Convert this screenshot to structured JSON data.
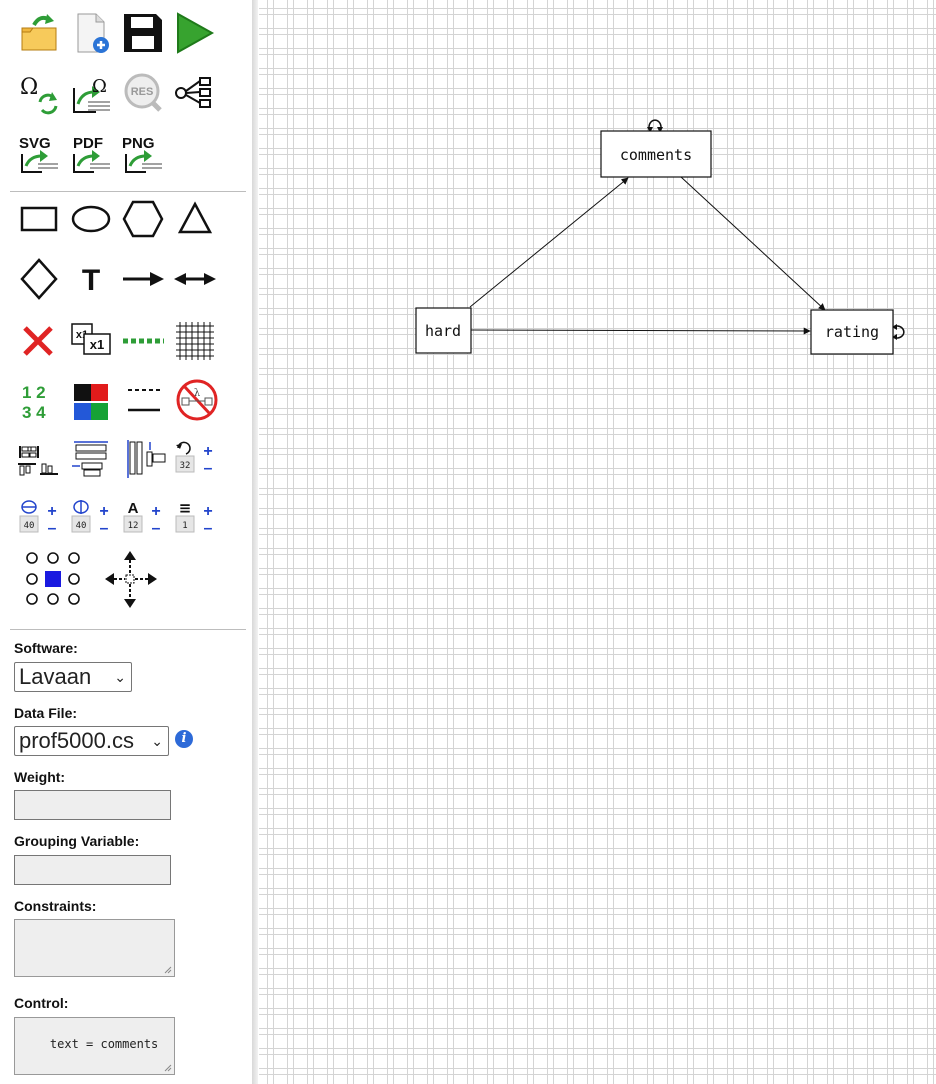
{
  "toolbar": {
    "export_svg": "SVG",
    "export_pdf": "PDF",
    "export_png": "PNG",
    "results": "RES",
    "text_tool": "T",
    "numbers_top": "1 2",
    "numbers_bottom": "3 4",
    "edge_variance": "x1",
    "edge_variance_sub": "x1",
    "rotation_value": "32",
    "width_value": "40",
    "height_value": "40",
    "font_size_value": "12",
    "line_width_value": "1",
    "glyph_omega": "Ω",
    "glyph_lambda": "λ",
    "glyph_font": "A",
    "glyph_lines": "≡",
    "glyph_plus": "+",
    "glyph_minus": "–"
  },
  "form": {
    "software_label": "Software:",
    "software_value": "Lavaan",
    "datafile_label": "Data File:",
    "datafile_value": "prof5000.cs",
    "info_glyph": "i",
    "weight_label": "Weight:",
    "weight_value": "",
    "grouping_label": "Grouping Variable:",
    "grouping_value": "",
    "constraints_label": "Constraints:",
    "constraints_value": "",
    "control_label": "Control:",
    "control_value": "text = comments"
  },
  "diagram": {
    "nodes": {
      "comments": "comments",
      "hard": "hard",
      "rating": "rating"
    },
    "paths": [
      {
        "from": "hard",
        "to": "comments"
      },
      {
        "from": "comments",
        "to": "rating"
      },
      {
        "from": "hard",
        "to": "rating"
      }
    ],
    "self_loops": [
      "comments",
      "rating"
    ]
  },
  "colors": {
    "green": "#2e9d37",
    "red": "#e02424",
    "blue": "#2244cc",
    "border": "#767676"
  }
}
